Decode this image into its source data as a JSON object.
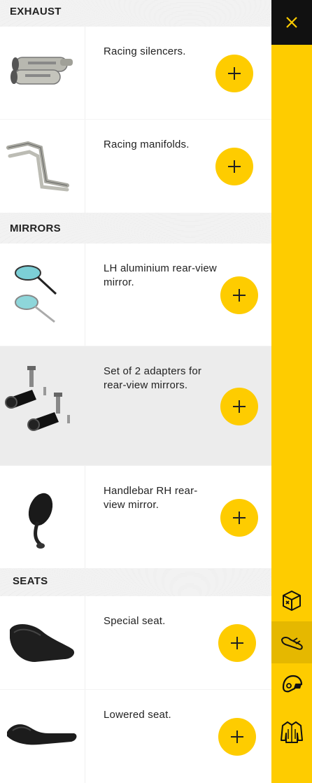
{
  "sections": {
    "exhaust": "EXHAUST",
    "mirrors": "MIRRORS",
    "seats": "SEATS"
  },
  "items": [
    {
      "label": "Racing silencers."
    },
    {
      "label": "Racing manifolds."
    },
    {
      "label": "LH aluminium rear-view mirror."
    },
    {
      "label": "Set of 2 adapters for rear-view mirrors."
    },
    {
      "label": "Handlebar RH rear-view mirror."
    },
    {
      "label": "Special seat."
    },
    {
      "label": "Lowered seat."
    }
  ],
  "rail": {
    "icons": [
      "close-icon",
      "accessories-box-icon",
      "parts-icon",
      "helmet-icon",
      "jacket-icon"
    ],
    "active": "parts-icon"
  },
  "colors": {
    "accent": "#fecc00",
    "dark": "#111111"
  }
}
